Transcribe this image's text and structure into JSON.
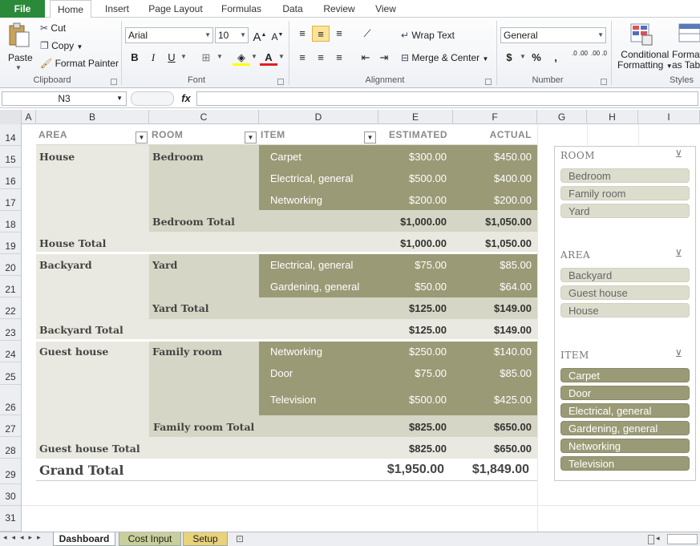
{
  "ribbon": {
    "file_tab": "File",
    "tabs": [
      "Home",
      "Insert",
      "Page Layout",
      "Formulas",
      "Data",
      "Review",
      "View"
    ],
    "clipboard": {
      "paste": "Paste",
      "cut": "Cut",
      "copy": "Copy",
      "format_painter": "Format Painter",
      "label": "Clipboard"
    },
    "font": {
      "name": "Arial",
      "size": "10",
      "label": "Font",
      "bold": "B",
      "italic": "I",
      "underline": "U"
    },
    "alignment": {
      "wrap_text": "Wrap Text",
      "merge_center": "Merge & Center",
      "label": "Alignment"
    },
    "number": {
      "format": "General",
      "label": "Number",
      "currency": "$",
      "percent": "%",
      "comma": ",",
      "inc_dec": ".0 .00",
      "dec_dec": ".00 .0"
    },
    "styles": {
      "conditional": "Conditional",
      "formatting": "Formatting",
      "format_as": "Format",
      "as_table": "as Table",
      "label": "Styles"
    }
  },
  "formula_bar": {
    "name_box": "N3",
    "fx": "fx"
  },
  "columns": [
    "A",
    "B",
    "C",
    "D",
    "E",
    "F",
    "G",
    "H",
    "I"
  ],
  "rows": [
    "14",
    "15",
    "16",
    "17",
    "18",
    "19",
    "20",
    "21",
    "22",
    "23",
    "24",
    "25",
    "26",
    "27",
    "28",
    "29",
    "30",
    "31"
  ],
  "pivot": {
    "headers": {
      "area": "AREA",
      "room": "ROOM",
      "item": "ITEM",
      "estimated": "ESTIMATED",
      "actual": "ACTUAL"
    },
    "blocks": [
      {
        "area": "House",
        "room": "Bedroom",
        "items": [
          {
            "name": "Carpet",
            "est": "$300.00",
            "act": "$450.00"
          },
          {
            "name": "Electrical, general",
            "est": "$500.00",
            "act": "$400.00"
          },
          {
            "name": "Networking",
            "est": "$200.00",
            "act": "$200.00"
          }
        ],
        "room_total": {
          "label": "Bedroom Total",
          "est": "$1,000.00",
          "act": "$1,050.00"
        },
        "area_total": {
          "label": "House Total",
          "est": "$1,000.00",
          "act": "$1,050.00"
        }
      },
      {
        "area": "Backyard",
        "room": "Yard",
        "items": [
          {
            "name": "Electrical, general",
            "est": "$75.00",
            "act": "$85.00"
          },
          {
            "name": "Gardening, general",
            "est": "$50.00",
            "act": "$64.00"
          }
        ],
        "room_total": {
          "label": "Yard Total",
          "est": "$125.00",
          "act": "$149.00"
        },
        "area_total": {
          "label": "Backyard Total",
          "est": "$125.00",
          "act": "$149.00"
        }
      },
      {
        "area": "Guest house",
        "room": "Family room",
        "items": [
          {
            "name": "Networking",
            "est": "$250.00",
            "act": "$140.00"
          },
          {
            "name": "Door",
            "est": "$75.00",
            "act": "$85.00"
          },
          {
            "name": "Television",
            "est": "$500.00",
            "act": "$425.00"
          }
        ],
        "room_total": {
          "label": "Family room Total",
          "est": "$825.00",
          "act": "$650.00"
        },
        "area_total": {
          "label": "Guest house Total",
          "est": "$825.00",
          "act": "$650.00"
        }
      }
    ],
    "grand_total": {
      "label": "Grand Total",
      "est": "$1,950.00",
      "act": "$1,849.00"
    }
  },
  "slicers": [
    {
      "title": "ROOM",
      "items": [
        "Bedroom",
        "Family room",
        "Yard"
      ]
    },
    {
      "title": "AREA",
      "items": [
        "Backyard",
        "Guest house",
        "House"
      ]
    },
    {
      "title": "ITEM",
      "items": [
        "Carpet",
        "Door",
        "Electrical, general",
        "Gardening, general",
        "Networking",
        "Television"
      ]
    }
  ],
  "sheets": [
    "Dashboard",
    "Cost Input",
    "Setup"
  ],
  "colors": {
    "dark_olive": "#9a9a76",
    "mid_olive": "#d6d6c6",
    "light": "#e8e8e0",
    "excel_green": "#2a8a3a"
  }
}
